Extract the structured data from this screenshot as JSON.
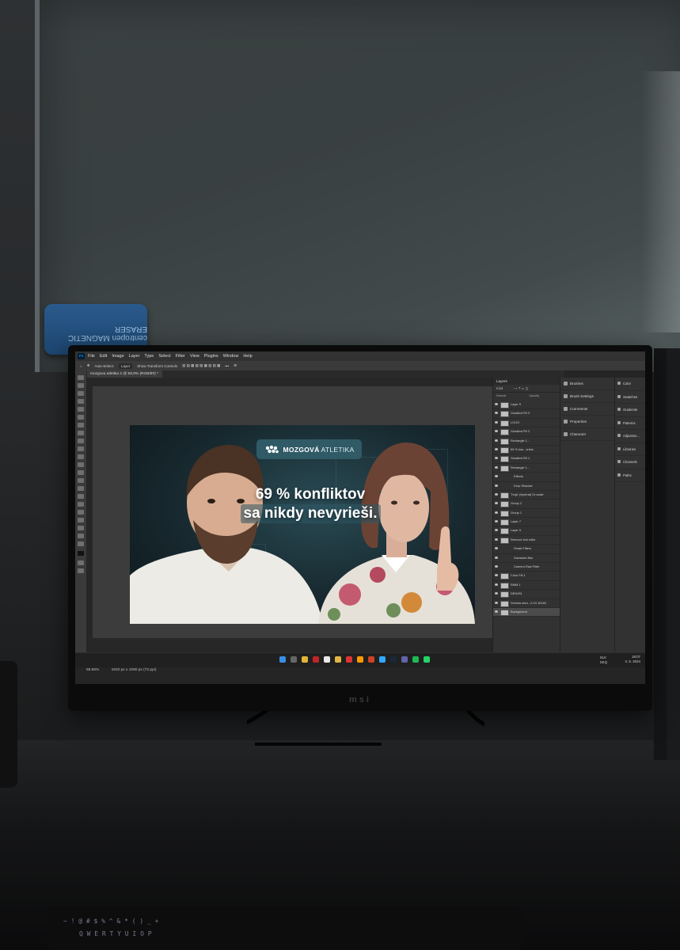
{
  "photoshop": {
    "app_icon": "Ps",
    "menu": [
      "File",
      "Edit",
      "Image",
      "Layer",
      "Type",
      "Select",
      "Filter",
      "View",
      "Plugins",
      "Window",
      "Help"
    ],
    "options": {
      "auto_select_label": "Auto-Select:",
      "auto_select_value": "Layer",
      "show_transform_label": "Show Transform Controls"
    },
    "document_tab": "mozgova atletika 2 @ 58,9% (RGB/8#) *",
    "status": {
      "zoom": "58.86%",
      "dimensions": "1920 px x 1080 px (72 ppi)"
    },
    "layers_panel": {
      "title": "Layers",
      "filter_kind": "Kind",
      "blend_label": "Normal",
      "opacity_label": "Opacity",
      "lock_label": "Lock",
      "fill_label": "Fill",
      "rows": [
        {
          "name": "Layer 9",
          "sub": false,
          "selected": false
        },
        {
          "name": "Gradient Fill 3",
          "sub": false,
          "selected": false
        },
        {
          "name": "LOGO",
          "sub": false,
          "selected": false
        },
        {
          "name": "Gradient Fill 2",
          "sub": false,
          "selected": false
        },
        {
          "name": "Rectangle 1...",
          "sub": false,
          "selected": false
        },
        {
          "name": "69 % kon...vriesi",
          "sub": false,
          "selected": false
        },
        {
          "name": "Gradient Fill 1",
          "sub": false,
          "selected": false
        },
        {
          "name": "Rectangle 1...",
          "sub": false,
          "selected": false
        },
        {
          "name": "Effects",
          "sub": true,
          "selected": false
        },
        {
          "name": "Drop Shadow",
          "sub": true,
          "selected": false
        },
        {
          "name": "Tvoje (Vyzerat) 2x scale",
          "sub": false,
          "selected": false
        },
        {
          "name": "Group 2",
          "sub": false,
          "selected": false
        },
        {
          "name": "Group 1",
          "sub": false,
          "selected": false
        },
        {
          "name": "Layer 7",
          "sub": false,
          "selected": false
        },
        {
          "name": "Layer 5",
          "sub": false,
          "selected": false
        },
        {
          "name": "Remove tool edits",
          "sub": false,
          "selected": false
        },
        {
          "name": "Smart Filters",
          "sub": true,
          "selected": false
        },
        {
          "name": "Gaussian Blur",
          "sub": true,
          "selected": false
        },
        {
          "name": "Camera Raw Filter",
          "sub": true,
          "selected": false
        },
        {
          "name": "Color Fill 1",
          "sub": false,
          "selected": false
        },
        {
          "name": "RMM 1",
          "sub": false,
          "selected": false
        },
        {
          "name": "DEN251",
          "sub": false,
          "selected": false
        },
        {
          "name": "Snimka obra...2-03 10183",
          "sub": false,
          "selected": false
        },
        {
          "name": "Background",
          "sub": false,
          "selected": true
        }
      ]
    },
    "mid_panels": [
      {
        "label": "Brushes",
        "icon": "brush-icon"
      },
      {
        "label": "Brush Settings",
        "icon": "brush-settings-icon"
      },
      {
        "label": "Comments",
        "icon": "comment-icon"
      },
      {
        "label": "Properties",
        "icon": "properties-icon"
      },
      {
        "label": "Character",
        "icon": "character-icon"
      }
    ],
    "right_panels": [
      {
        "label": "Color",
        "icon": "color-icon"
      },
      {
        "label": "Swatches",
        "icon": "swatches-icon"
      },
      {
        "label": "Gradients",
        "icon": "gradients-icon"
      },
      {
        "label": "Patterns",
        "icon": "patterns-icon"
      },
      {
        "label": "Adjustme...",
        "icon": "adjustments-icon"
      },
      {
        "label": "Libraries",
        "icon": "libraries-icon"
      },
      {
        "label": "Channels",
        "icon": "channels-icon"
      },
      {
        "label": "Paths",
        "icon": "paths-icon"
      }
    ]
  },
  "thumbnail": {
    "logo_a": "MOZGOVÁ",
    "logo_b": "ATLETIKA",
    "headline_1": "69 % konfliktov",
    "headline_2": "sa nikdy nevyrieši.",
    "colors": {
      "pill": "#2f5a66",
      "background": "#17282e"
    }
  },
  "taskbar": {
    "lang_1": "SLK",
    "lang_2": "SKQ",
    "time": "18:07",
    "date": "3. 5. 2024"
  },
  "monitor_brand": "msi",
  "eraser_text": "centropen MAGNETIC ERASER"
}
